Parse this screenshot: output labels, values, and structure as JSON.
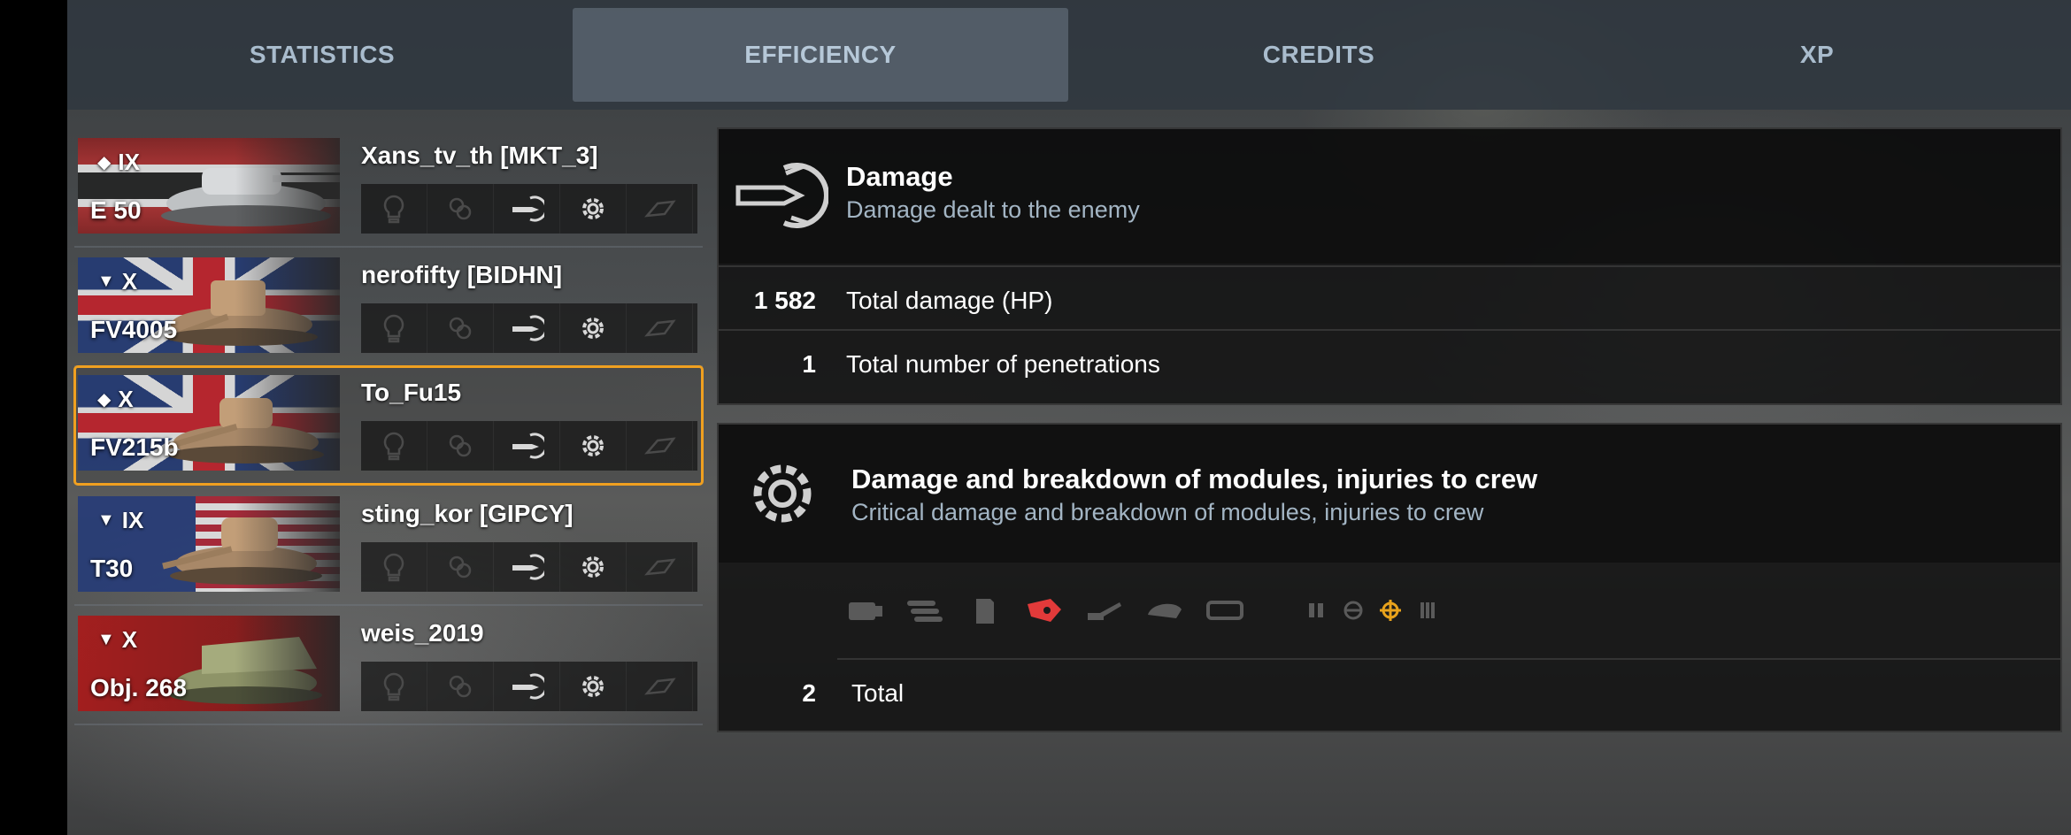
{
  "tabs": [
    {
      "label": "STATISTICS"
    },
    {
      "label": "EFFICIENCY",
      "active": true
    },
    {
      "label": "CREDITS"
    },
    {
      "label": "XP"
    }
  ],
  "players": [
    {
      "tier": "IX",
      "tank": "E 50",
      "name": "Xans_tv_th [MKT_3]",
      "class_icon": "medium-tank-icon",
      "nation": "germany"
    },
    {
      "tier": "X",
      "tank": "FV4005",
      "name": "nerofifty [BIDHN]",
      "class_icon": "td-icon",
      "nation": "uk"
    },
    {
      "tier": "X",
      "tank": "FV215b",
      "name": "To_Fu15",
      "class_icon": "medium-tank-icon",
      "nation": "uk",
      "selected": true
    },
    {
      "tier": "IX",
      "tank": "T30",
      "name": "sting_kor [GIPCY]",
      "class_icon": "td-icon",
      "nation": "usa"
    },
    {
      "tier": "X",
      "tank": "Obj. 268",
      "name": "weis_2019",
      "class_icon": "td-icon",
      "nation": "ussr"
    }
  ],
  "medal_icons": [
    "spotting-bulb-icon",
    "assist-icon",
    "damage-shell-icon",
    "module-gear-icon",
    "blocked-armor-icon"
  ],
  "damage_panel": {
    "title": "Damage",
    "subtitle": "Damage dealt to the enemy",
    "rows": [
      {
        "value": "1 582",
        "label": "Total damage (HP)"
      },
      {
        "value": "1",
        "label": "Total number of penetrations"
      }
    ]
  },
  "modules_panel": {
    "title": "Damage and breakdown of modules, injuries to crew",
    "subtitle": "Critical damage and breakdown of modules, injuries to crew",
    "module_icons": [
      {
        "name": "engine-icon",
        "state": "inactive"
      },
      {
        "name": "ammo-rack-icon",
        "state": "inactive"
      },
      {
        "name": "fuel-tank-icon",
        "state": "inactive"
      },
      {
        "name": "radio-icon",
        "state": "damaged",
        "color": "#e23a3a"
      },
      {
        "name": "gun-icon",
        "state": "inactive"
      },
      {
        "name": "turret-icon",
        "state": "inactive"
      },
      {
        "name": "track-icon",
        "state": "inactive"
      }
    ],
    "crew_icons": [
      {
        "name": "commander-icon",
        "state": "inactive"
      },
      {
        "name": "driver-icon",
        "state": "inactive"
      },
      {
        "name": "gunner-icon",
        "state": "injured",
        "color": "#e8a21c"
      },
      {
        "name": "loader-icon",
        "state": "inactive"
      }
    ],
    "total": {
      "value": "2",
      "label": "Total"
    }
  },
  "colors": {
    "selected_outline": "#f0a020",
    "tab_text": "#a9bccd",
    "subtitle": "#a3b5c4"
  }
}
